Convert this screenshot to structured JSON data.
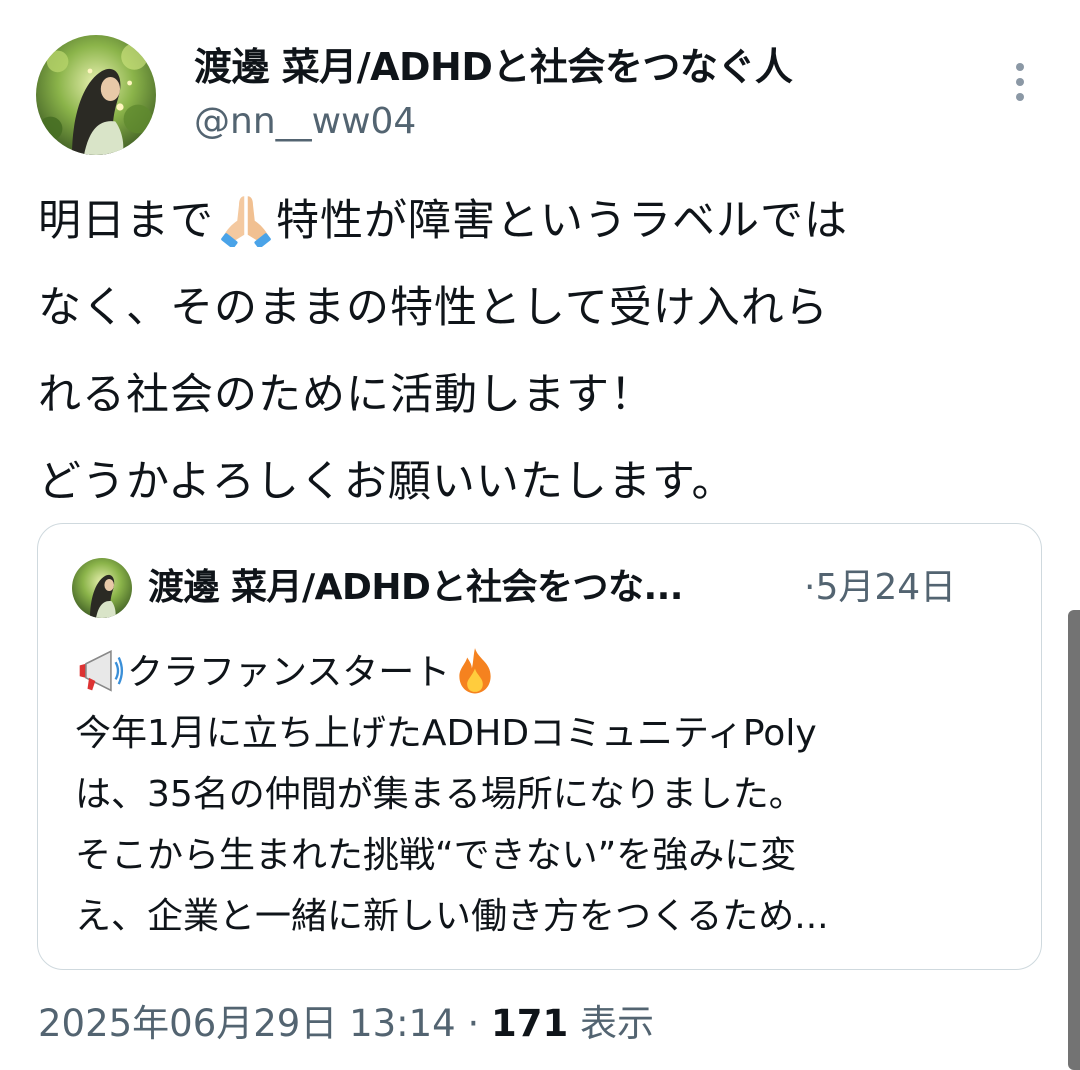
{
  "tweet": {
    "display_name": "渡邊 菜月/ADHDと社会をつなぐ人",
    "handle": "@nn__ww04",
    "more_icon": "more-vertical-icon",
    "text_lines": [
      {
        "before": "明日まで",
        "emoji": "folded-hands-emoji",
        "after": "特性が障害というラベルでは"
      },
      {
        "text": "なく、そのままの特性として受け入れら"
      },
      {
        "text": "れる社会のために活動します！"
      },
      {
        "text": "どうかよろしくお願いいたします。"
      }
    ],
    "timestamp": "2025年06月29日 13:14",
    "separator": "·",
    "views_count": "171",
    "views_label": "表示"
  },
  "quote": {
    "display_name": "渡邊 菜月/ADHDと社会をつな...",
    "separator": "·",
    "date": "5月24日",
    "lines": [
      {
        "emoji_before": "megaphone-emoji",
        "text": "クラファンスタート",
        "emoji_after": "fire-emoji"
      },
      {
        "text": "今年1月に立ち上げたADHDコミュニティPoly"
      },
      {
        "text": "は、35名の仲間が集まる場所になりました。"
      },
      {
        "text": "そこから生まれた挑戦“できない”を強みに変"
      },
      {
        "text": "え、企業と一緒に新しい働き方をつくるため..."
      }
    ]
  },
  "colors": {
    "text_primary": "#0f1419",
    "text_secondary": "#536471",
    "border": "#cfd9de",
    "avatar_green": "#6f9a3c"
  }
}
